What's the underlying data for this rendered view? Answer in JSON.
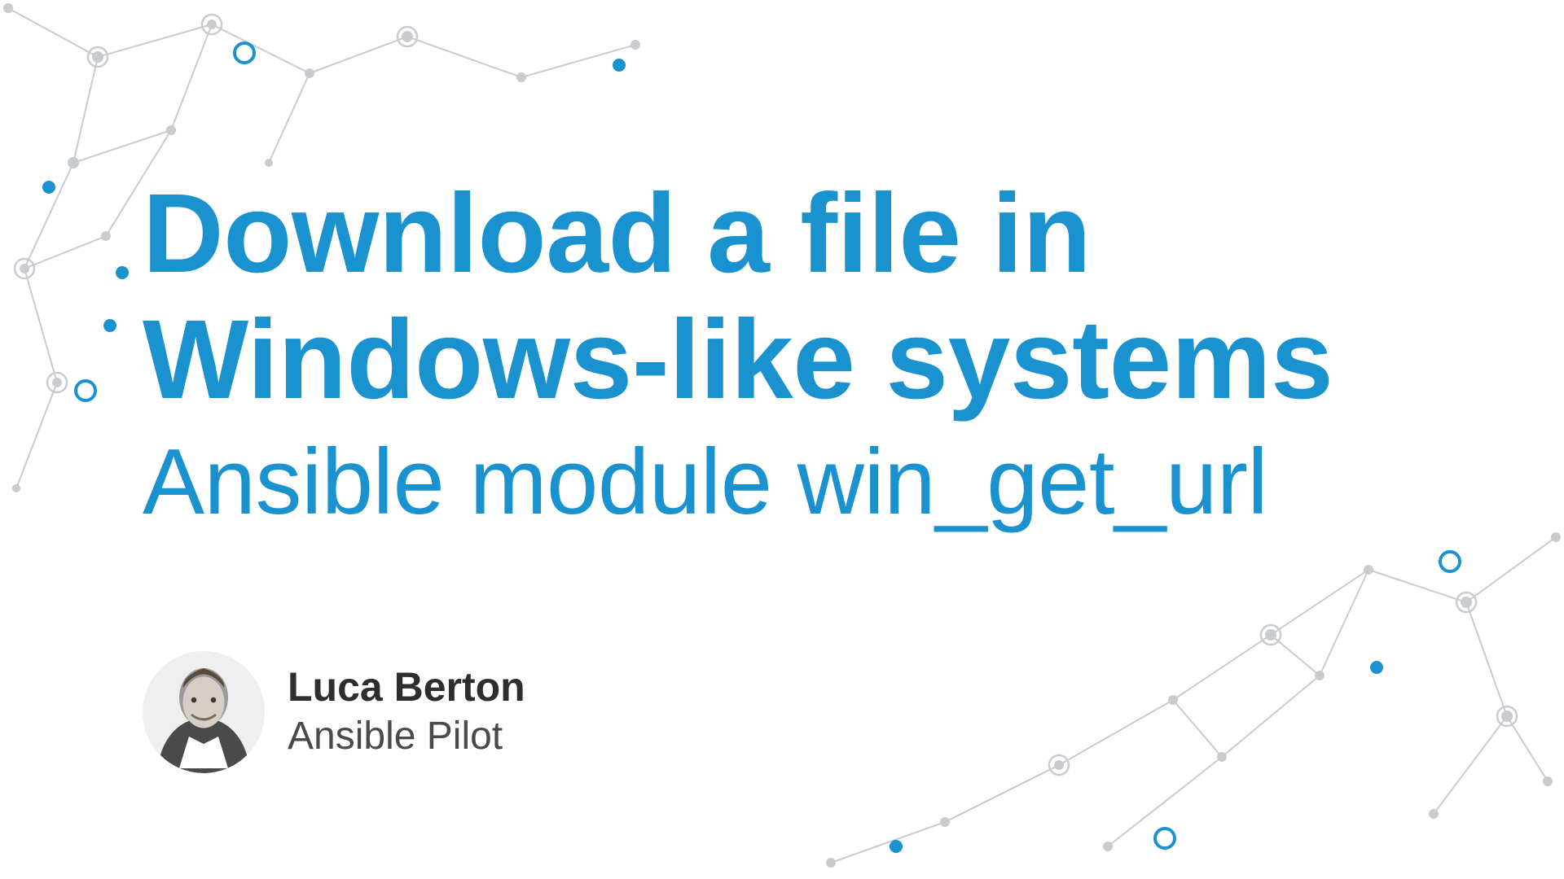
{
  "colors": {
    "accent": "#1b92d0",
    "graph_light": "#c8cbcf",
    "text_dark": "#2e2e2e",
    "text_muted": "#4a4a4a"
  },
  "title": {
    "line1": "Download a file  in",
    "line2": "Windows-like systems"
  },
  "subtitle": "Ansible module win_get_url",
  "author": {
    "name": "Luca Berton",
    "role": "Ansible Pilot"
  }
}
